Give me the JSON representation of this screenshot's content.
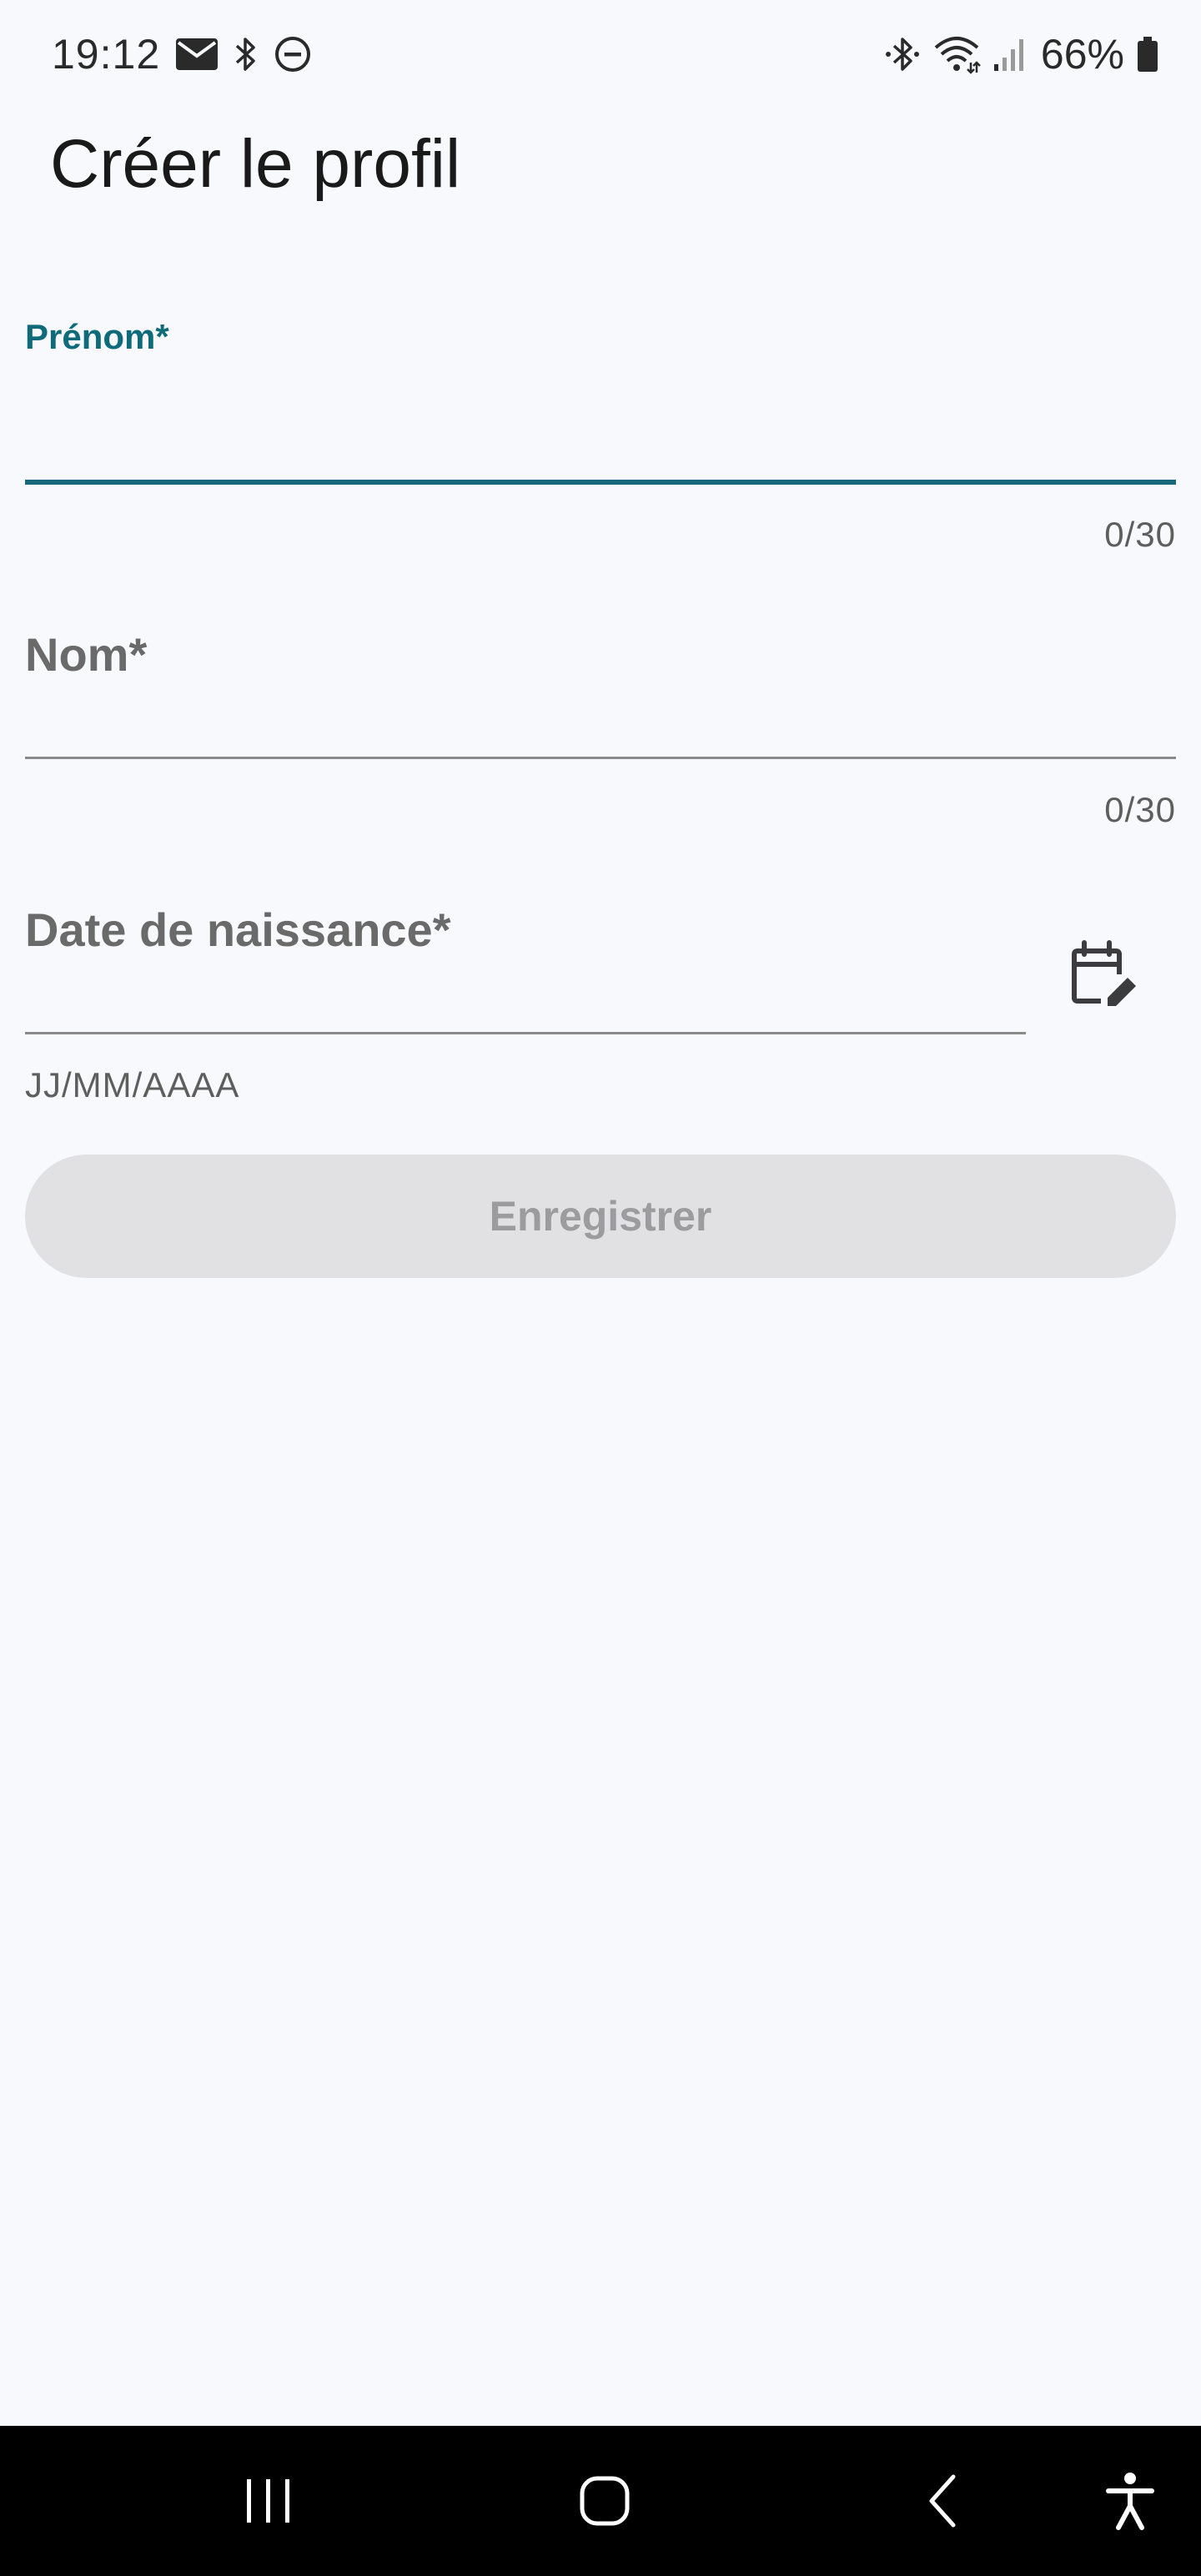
{
  "status_bar": {
    "time": "19:12",
    "battery_percent": "66%",
    "icons_left": [
      "mail-icon",
      "bluetooth-icon",
      "do-not-disturb-icon"
    ],
    "icons_right": [
      "bluetooth-icon",
      "wifi-icon",
      "signal-icon",
      "battery-icon"
    ]
  },
  "header": {
    "title": "Créer le profil"
  },
  "form": {
    "first_name": {
      "label": "Prénom*",
      "value": "",
      "counter": "0/30"
    },
    "last_name": {
      "label": "Nom*",
      "value": "",
      "counter": "0/30"
    },
    "birth_date": {
      "label": "Date de naissance*",
      "value": "",
      "helper": "JJ/MM/AAAA",
      "icon": "calendar-edit-icon"
    },
    "save_label": "Enregistrer"
  },
  "nav_bar": {
    "icons": [
      "recent-apps-icon",
      "home-icon",
      "back-icon",
      "accessibility-icon"
    ]
  },
  "colors": {
    "accent": "#16687a",
    "background": "#f8f9fc",
    "disabled_button": "#e1e1e3",
    "disabled_text": "#9c9c9f"
  }
}
